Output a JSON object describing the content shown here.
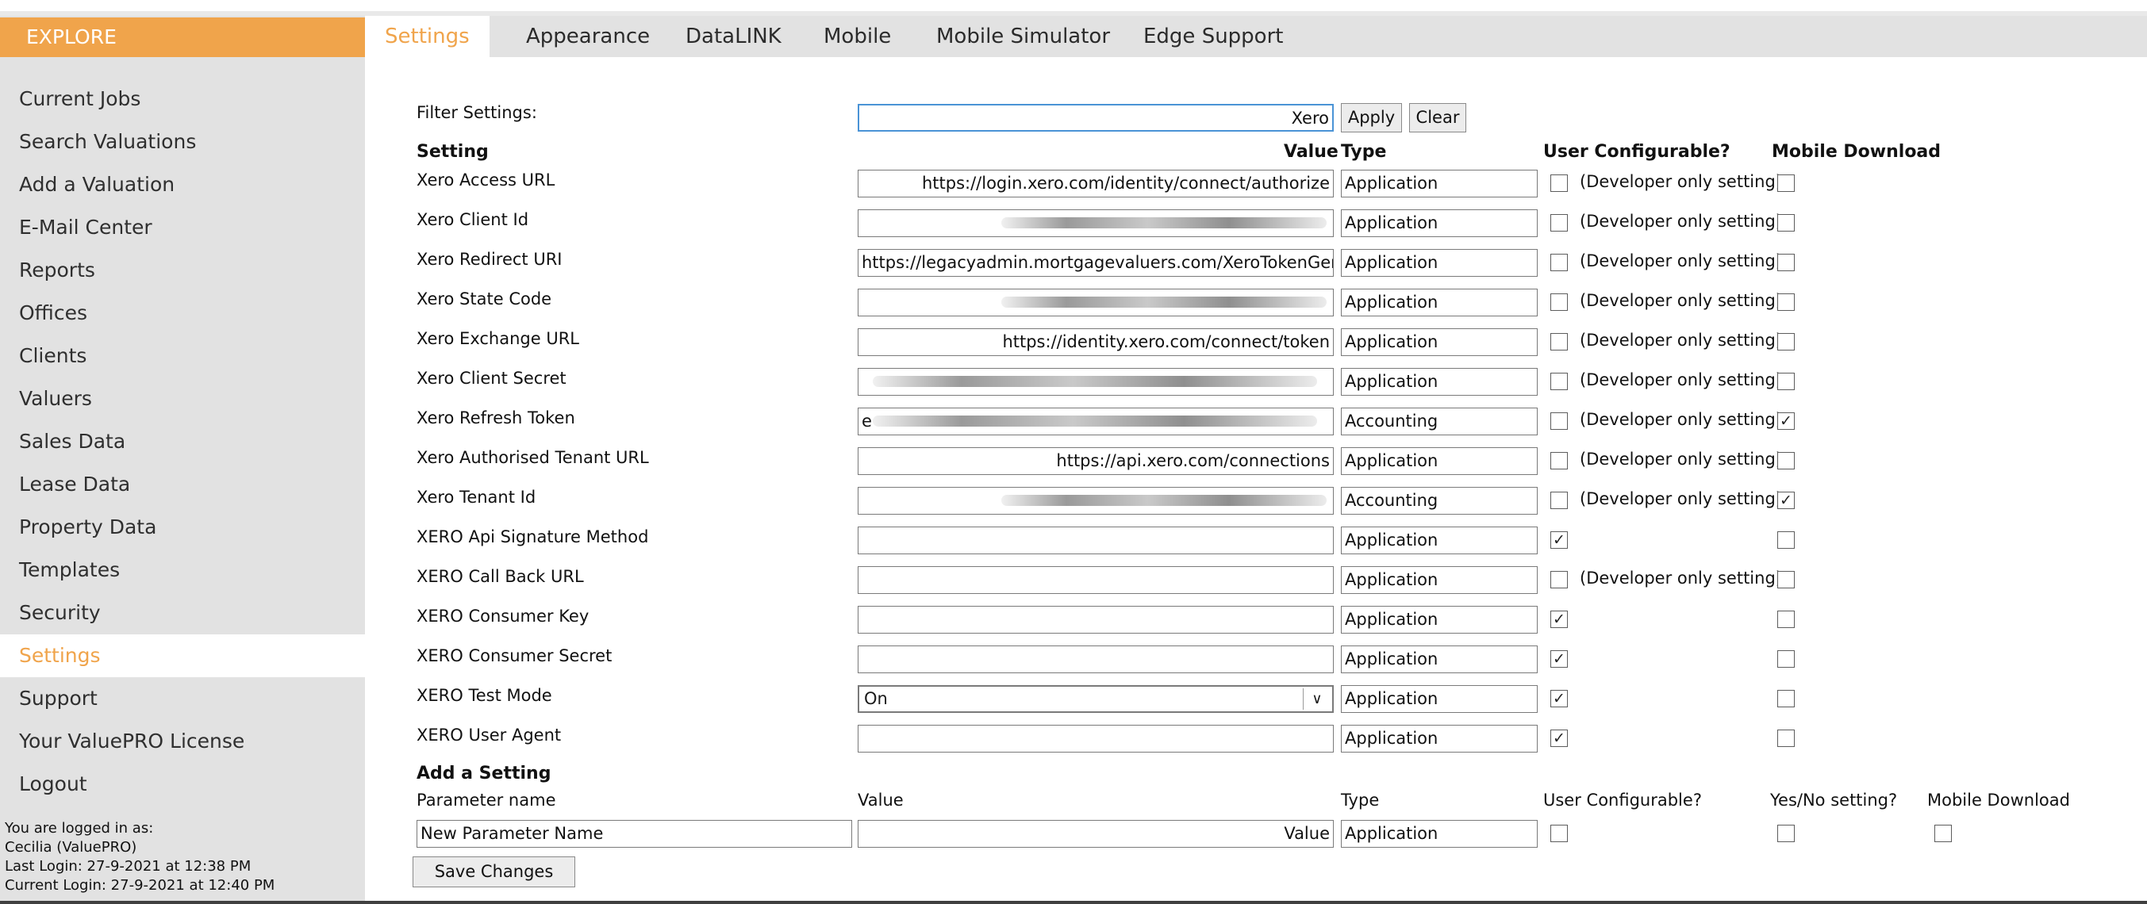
{
  "sidebar": {
    "header": "EXPLORE",
    "items": [
      {
        "label": "Current Jobs"
      },
      {
        "label": "Search Valuations"
      },
      {
        "label": "Add a Valuation"
      },
      {
        "label": "E-Mail Center"
      },
      {
        "label": "Reports"
      },
      {
        "label": "Offices"
      },
      {
        "label": "Clients"
      },
      {
        "label": "Valuers"
      },
      {
        "label": "Sales Data"
      },
      {
        "label": "Lease Data"
      },
      {
        "label": "Property Data"
      },
      {
        "label": "Templates"
      },
      {
        "label": "Security"
      },
      {
        "label": "Settings"
      },
      {
        "label": "Support"
      },
      {
        "label": "Your ValuePRO License"
      },
      {
        "label": "Logout"
      }
    ],
    "active": "Settings",
    "login": {
      "logged_in_as": "You are logged in as:",
      "user": "Cecilia (ValuePRO)",
      "last_login": "Last Login: 27-9-2021 at 12:38 PM",
      "current_login": "Current Login: 27-9-2021 at 12:40 PM"
    }
  },
  "tabs": [
    {
      "label": "Settings"
    },
    {
      "label": "Appearance"
    },
    {
      "label": "DataLINK"
    },
    {
      "label": "Mobile"
    },
    {
      "label": "Mobile Simulator"
    },
    {
      "label": "Edge Support"
    }
  ],
  "filter": {
    "label": "Filter Settings:",
    "value": "Xero",
    "apply_label": "Apply",
    "clear_label": "Clear"
  },
  "columns": {
    "setting": "Setting",
    "value": "Value",
    "type": "Type",
    "user_configurable": "User Configurable?",
    "mobile_download": "Mobile Download"
  },
  "dev_only_text": "(Developer only setting)",
  "settings": [
    {
      "name": "Xero Access URL",
      "value": "https://login.xero.com/identity/connect/authorize",
      "align": "right",
      "redacted": false,
      "type": "Application",
      "dev_only": true,
      "user_configurable": false,
      "mobile_download": false
    },
    {
      "name": "Xero Client Id",
      "value": "",
      "align": "right",
      "redacted": true,
      "type": "Application",
      "dev_only": true,
      "user_configurable": false,
      "mobile_download": false
    },
    {
      "name": "Xero Redirect URI",
      "value": "https://legacyadmin.mortgagevaluers.com/XeroTokenGenerat",
      "align": "left",
      "redacted": false,
      "type": "Application",
      "dev_only": true,
      "user_configurable": false,
      "mobile_download": false
    },
    {
      "name": "Xero State Code",
      "value": "",
      "align": "right",
      "redacted": true,
      "type": "Application",
      "dev_only": true,
      "user_configurable": false,
      "mobile_download": false
    },
    {
      "name": "Xero Exchange URL",
      "value": "https://identity.xero.com/connect/token",
      "align": "right",
      "redacted": false,
      "type": "Application",
      "dev_only": true,
      "user_configurable": false,
      "mobile_download": false
    },
    {
      "name": "Xero Client Secret",
      "value": "",
      "align": "left",
      "redacted": true,
      "type": "Application",
      "dev_only": true,
      "user_configurable": false,
      "mobile_download": false
    },
    {
      "name": "Xero Refresh Token",
      "value": "e",
      "align": "left",
      "redacted": true,
      "type": "Accounting",
      "dev_only": true,
      "user_configurable": false,
      "mobile_download": true
    },
    {
      "name": "Xero Authorised Tenant URL",
      "value": "https://api.xero.com/connections",
      "align": "right",
      "redacted": false,
      "type": "Application",
      "dev_only": true,
      "user_configurable": false,
      "mobile_download": false
    },
    {
      "name": "Xero Tenant Id",
      "value": "",
      "align": "right",
      "redacted": true,
      "type": "Accounting",
      "dev_only": true,
      "user_configurable": false,
      "mobile_download": true
    },
    {
      "name": "XERO Api Signature Method",
      "value": "",
      "align": "left",
      "redacted": false,
      "type": "Application",
      "dev_only": false,
      "user_configurable": true,
      "mobile_download": false
    },
    {
      "name": "XERO Call Back URL",
      "value": "",
      "align": "left",
      "redacted": false,
      "type": "Application",
      "dev_only": true,
      "user_configurable": false,
      "mobile_download": false
    },
    {
      "name": "XERO Consumer Key",
      "value": "",
      "align": "left",
      "redacted": false,
      "type": "Application",
      "dev_only": false,
      "user_configurable": true,
      "mobile_download": false
    },
    {
      "name": "XERO Consumer Secret",
      "value": "",
      "align": "left",
      "redacted": false,
      "type": "Application",
      "dev_only": false,
      "user_configurable": true,
      "mobile_download": false
    },
    {
      "name": "XERO Test Mode",
      "value": "On",
      "align": "left",
      "redacted": false,
      "is_select": true,
      "type": "Application",
      "dev_only": false,
      "user_configurable": true,
      "mobile_download": false
    },
    {
      "name": "XERO User Agent",
      "value": "",
      "align": "left",
      "redacted": false,
      "type": "Application",
      "dev_only": false,
      "user_configurable": true,
      "mobile_download": false
    }
  ],
  "add_setting": {
    "title": "Add a Setting",
    "col_param": "Parameter name",
    "col_value": "Value",
    "col_type": "Type",
    "col_user_configurable": "User Configurable?",
    "col_yes_no": "Yes/No setting?",
    "col_mobile_download": "Mobile Download",
    "param_value": "New Parameter Name",
    "value_value": "Value",
    "type_value": "Application"
  },
  "save_label": "Save Changes",
  "colors": {
    "accent": "#f0a44b",
    "sidebar_bg": "#e2e2e2"
  }
}
